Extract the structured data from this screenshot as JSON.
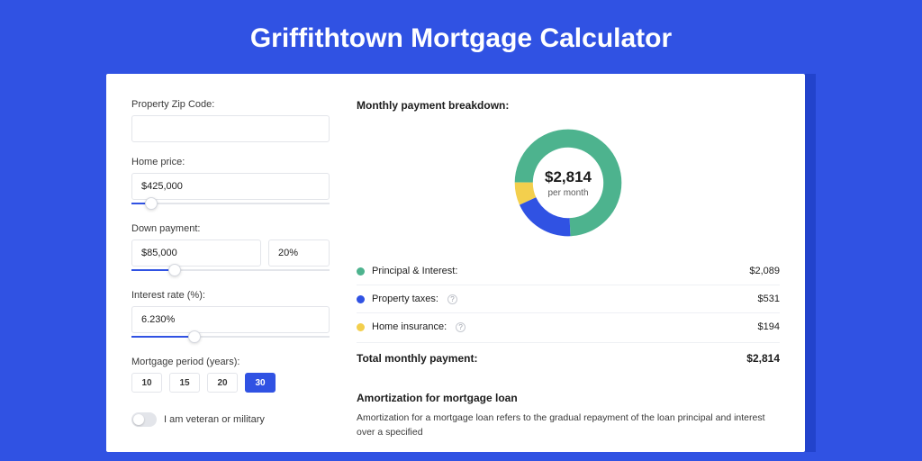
{
  "page_title": "Griffithtown Mortgage Calculator",
  "form": {
    "zip_label": "Property Zip Code:",
    "zip_value": "",
    "home_price_label": "Home price:",
    "home_price_value": "$425,000",
    "home_price_slider_pct": 10,
    "down_payment_label": "Down payment:",
    "down_payment_value": "$85,000",
    "down_payment_pct_value": "20%",
    "down_payment_slider_pct": 22,
    "interest_label": "Interest rate (%):",
    "interest_value": "6.230%",
    "interest_slider_pct": 32,
    "period_label": "Mortgage period (years):",
    "period_options": [
      "10",
      "15",
      "20",
      "30"
    ],
    "period_selected": "30",
    "veteran_label": "I am veteran or military",
    "veteran_on": false
  },
  "breakdown": {
    "heading": "Monthly payment breakdown:",
    "total_amount": "$2,814",
    "total_sub": "per month",
    "items": [
      {
        "label": "Principal & Interest:",
        "value": "$2,089",
        "color": "#4db38e",
        "info": false
      },
      {
        "label": "Property taxes:",
        "value": "$531",
        "color": "#3052e3",
        "info": true
      },
      {
        "label": "Home insurance:",
        "value": "$194",
        "color": "#f3cf4d",
        "info": true
      }
    ],
    "total_label": "Total monthly payment:",
    "total_value": "$2,814"
  },
  "chart_data": {
    "type": "pie",
    "title": "Monthly payment breakdown",
    "series": [
      {
        "name": "Principal & Interest",
        "value": 2089,
        "color": "#4db38e"
      },
      {
        "name": "Property taxes",
        "value": 531,
        "color": "#3052e3"
      },
      {
        "name": "Home insurance",
        "value": 194,
        "color": "#f3cf4d"
      }
    ],
    "total": 2814,
    "center_label": "$2,814",
    "center_sub": "per month"
  },
  "amortization": {
    "heading": "Amortization for mortgage loan",
    "body": "Amortization for a mortgage loan refers to the gradual repayment of the loan principal and interest over a specified"
  }
}
